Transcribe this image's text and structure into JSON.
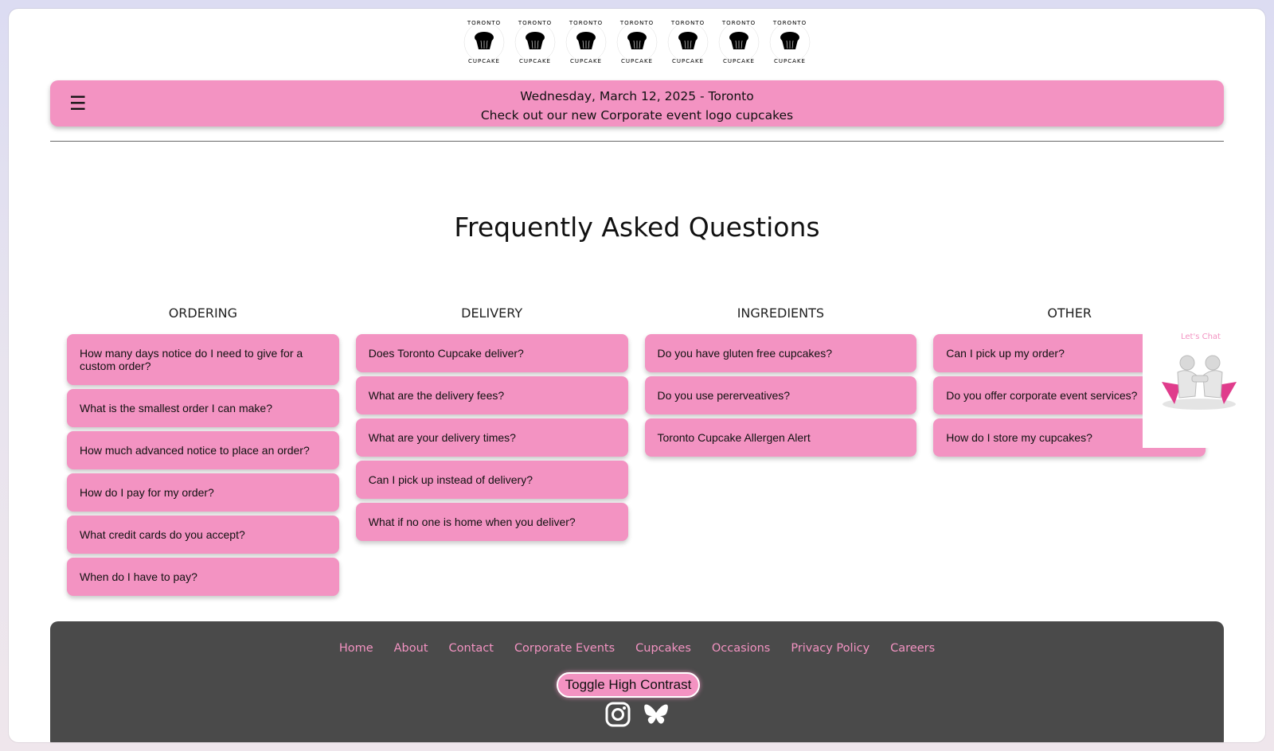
{
  "header": {
    "logo_top_text": "TORONTO",
    "logo_bottom_text": "CUPCAKE",
    "logo_count": 7
  },
  "banner": {
    "menu_icon": "hamburger-menu-icon",
    "date_line": "Wednesday, March 12, 2025 - Toronto",
    "promo_line": "Check out our new Corporate event logo cupcakes"
  },
  "page_title": "Frequently Asked Questions",
  "columns": [
    {
      "heading": "ORDERING",
      "items": [
        "How many days notice do I need to give for a custom order?",
        "What is the smallest order I can make?",
        "How much advanced notice to place an order?",
        "How do I pay for my order?",
        "What credit cards do you accept?",
        "When do I have to pay?"
      ]
    },
    {
      "heading": "DELIVERY",
      "items": [
        "Does Toronto Cupcake deliver?",
        "What are the delivery fees?",
        "What are your delivery times?",
        "Can I pick up instead of delivery?",
        "What if no one is home when you deliver?"
      ]
    },
    {
      "heading": "INGREDIENTS",
      "items": [
        "Do you have gluten free cupcakes?",
        "Do you use pererveatives?",
        "Toronto Cupcake Allergen Alert"
      ]
    },
    {
      "heading": "OTHER",
      "items": [
        "Can I pick up my order?",
        "Do you offer corporate event services?",
        "How do I store my cupcakes?"
      ]
    }
  ],
  "chat": {
    "label": "Let's Chat",
    "icon": "chat-people-icon"
  },
  "footer": {
    "links": [
      "Home",
      "About",
      "Contact",
      "Corporate Events",
      "Cupcakes",
      "Occasions",
      "Privacy Policy",
      "Careers"
    ],
    "toggle_label": "Toggle High Contrast",
    "social_icons": [
      "instagram-icon",
      "bluesky-icon"
    ]
  },
  "colors": {
    "accent_pink": "#f393c2",
    "footer_bg": "#4a4a4a"
  }
}
